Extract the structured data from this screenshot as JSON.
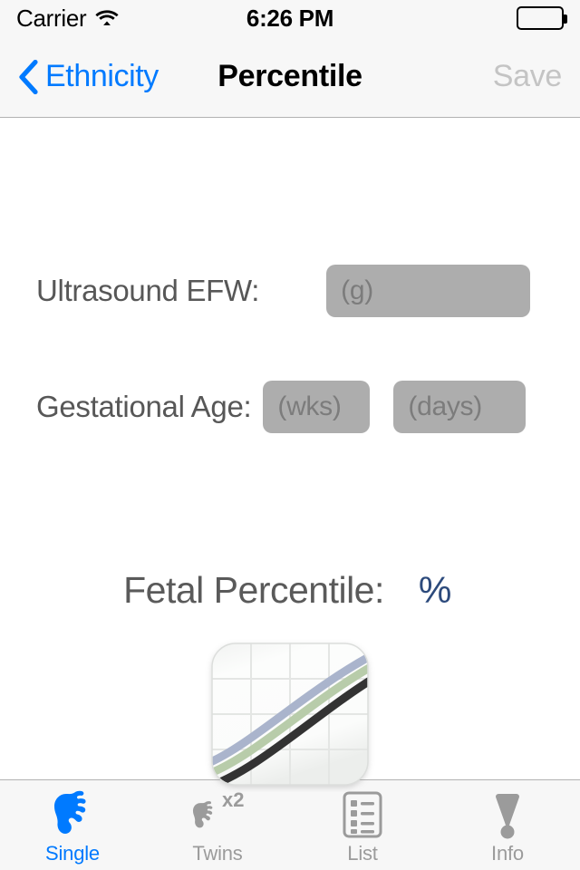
{
  "status_bar": {
    "carrier": "Carrier",
    "wifi_icon": "wifi-icon",
    "time": "6:26 PM",
    "battery_icon": "battery-full-icon"
  },
  "nav_bar": {
    "back_icon": "chevron-left-icon",
    "back_label": "Ethnicity",
    "title": "Percentile",
    "save_label": "Save",
    "save_enabled": false
  },
  "form": {
    "efw": {
      "label": "Ultrasound EFW:",
      "value": "",
      "placeholder": "(g)"
    },
    "gestational_age": {
      "label": "Gestational Age:",
      "weeks": {
        "value": "",
        "placeholder": "(wks)"
      },
      "days": {
        "value": "",
        "placeholder": "(days)"
      }
    }
  },
  "result": {
    "label": "Fetal Percentile:",
    "value": "",
    "unit": "%",
    "unit_color": "#2c4a7c"
  },
  "chart_icon": {
    "name": "growth-chart-icon",
    "line_colors": [
      "#aab4cc",
      "#b8ccaa",
      "#333333"
    ],
    "grid_color": "#e4e6e4",
    "background": "#fafbfa"
  },
  "tab_bar": {
    "items": [
      {
        "label": "Single",
        "icon": "fetus-icon",
        "active": true
      },
      {
        "label": "Twins",
        "icon": "fetus-x2-icon",
        "active": false
      },
      {
        "label": "List",
        "icon": "list-document-icon",
        "active": false
      },
      {
        "label": "Info",
        "icon": "exclamation-icon",
        "active": false
      }
    ],
    "active_color": "#007aff",
    "inactive_color": "#9b9b9b"
  }
}
